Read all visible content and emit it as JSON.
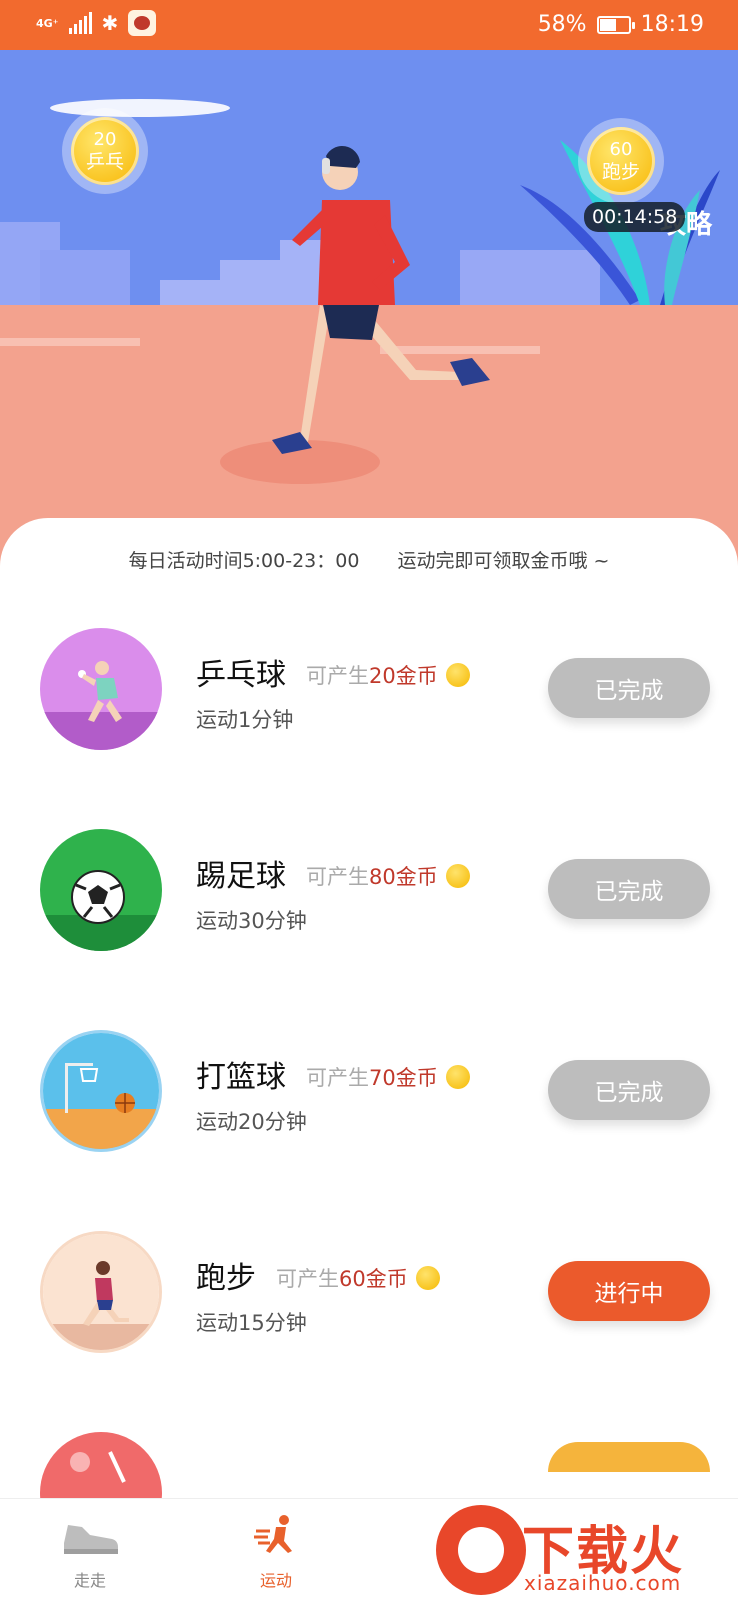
{
  "status_bar": {
    "network_label": "4G⁺",
    "battery_percent": "58%",
    "battery_level": 0.58,
    "time": "18:19",
    "icons": [
      "signal-icon",
      "bluetooth-icon",
      "app-notification-icon",
      "battery-icon"
    ]
  },
  "hero": {
    "bubble_left": {
      "number": "20",
      "label": "乒乓"
    },
    "bubble_right": {
      "number": "60",
      "label": "跑步"
    },
    "timer": "00:14:58",
    "strategy_label": "攻略"
  },
  "notice": {
    "hours": "每日活动时间5:00-23：00",
    "hint": "运动完即可领取金币哦 ~"
  },
  "activities": [
    {
      "name": "乒乓球",
      "reward_prefix": "可产生",
      "reward_amount": "20金币",
      "duration": "运动1分钟",
      "status": "已完成",
      "state": "done"
    },
    {
      "name": "踢足球",
      "reward_prefix": "可产生",
      "reward_amount": "80金币",
      "duration": "运动30分钟",
      "status": "已完成",
      "state": "done"
    },
    {
      "name": "打篮球",
      "reward_prefix": "可产生",
      "reward_amount": "70金币",
      "duration": "运动20分钟",
      "status": "已完成",
      "state": "done"
    },
    {
      "name": "跑步",
      "reward_prefix": "可产生",
      "reward_amount": "60金币",
      "duration": "运动15分钟",
      "status": "进行中",
      "state": "active"
    }
  ],
  "bottom_nav": {
    "walk": "走走",
    "sport": "运动"
  },
  "watermark": {
    "main": "下载火",
    "sub": "xiazaihuo.com"
  },
  "colors": {
    "status_bar": "#F26A2E",
    "done_button": "#BDBDBD",
    "active_button": "#EB5A2C",
    "reward_amount": "#C0392B"
  }
}
